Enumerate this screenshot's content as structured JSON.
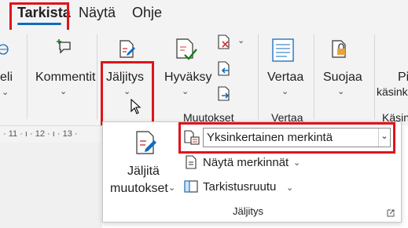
{
  "tabs": [
    {
      "label": "Tarkista",
      "selected": true
    },
    {
      "label": "Näytä",
      "selected": false
    },
    {
      "label": "Ohje",
      "selected": false
    }
  ],
  "ribbon": {
    "left_partial_label": "eli",
    "comments_label": "Kommentit",
    "tracking_label": "Jäljitys",
    "accept_label": "Hyväksy",
    "compare_label": "Vertaa",
    "protect_label": "Suojaa",
    "right_partial_label_1": "Pi",
    "right_partial_label_2": "käsink",
    "groups": {
      "changes": "Muutokset",
      "compare": "Vertaa",
      "right_partial": "Käsin"
    }
  },
  "ruler": {
    "ticks": "· 11 · ı · 12 · ı · 13 ·"
  },
  "popup": {
    "track_changes_line1": "Jäljitä",
    "track_changes_line2": "muutokset",
    "markup_mode_value": "Yksinkertainen merkintä",
    "show_markup_label": "Näytä merkinnät",
    "review_pane_label": "Tarkistusruutu",
    "group_label": "Jäljitys"
  },
  "colors": {
    "accent": "#0f6cbd",
    "highlight_box": "#e0141b",
    "reject_red": "#d13438",
    "accept_green": "#107c10"
  }
}
